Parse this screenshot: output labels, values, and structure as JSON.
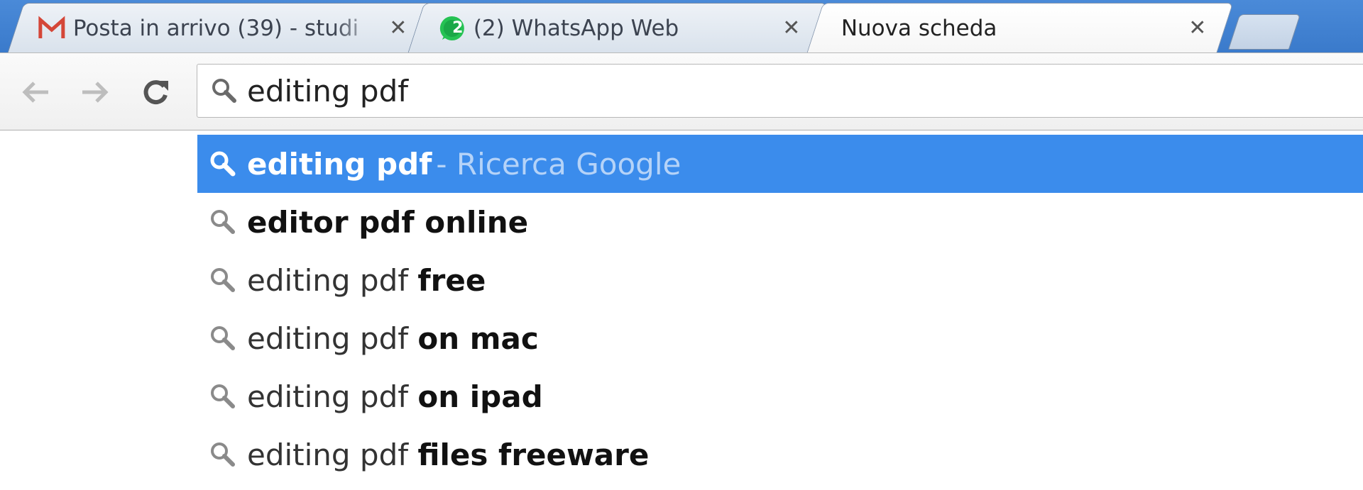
{
  "tabs": [
    {
      "title": "Posta in arrivo (39) - studi",
      "favicon": "gmail-icon",
      "badge": ""
    },
    {
      "title": "(2) WhatsApp Web",
      "favicon": "whatsapp-icon",
      "badge": "2"
    },
    {
      "title": "Nuova scheda",
      "favicon": "",
      "badge": ""
    }
  ],
  "tab_close_glyph": "✕",
  "omnibox": {
    "value": "editing pdf"
  },
  "suggestions": [
    {
      "plain": "",
      "bold": "editing pdf",
      "desc": "- Ricerca Google"
    },
    {
      "plain": "",
      "bold": "editor pdf online",
      "desc": ""
    },
    {
      "plain": "editing pdf ",
      "bold": "free",
      "desc": ""
    },
    {
      "plain": "editing pdf ",
      "bold": "on mac",
      "desc": ""
    },
    {
      "plain": "editing pdf ",
      "bold": "on ipad",
      "desc": ""
    },
    {
      "plain": "editing pdf ",
      "bold": "files freeware",
      "desc": ""
    }
  ],
  "colors": {
    "selected_row": "#3b8cec",
    "tabstrip": "#3a7acb",
    "gmail_red": "#d44638",
    "whatsapp_green": "#25c253"
  }
}
